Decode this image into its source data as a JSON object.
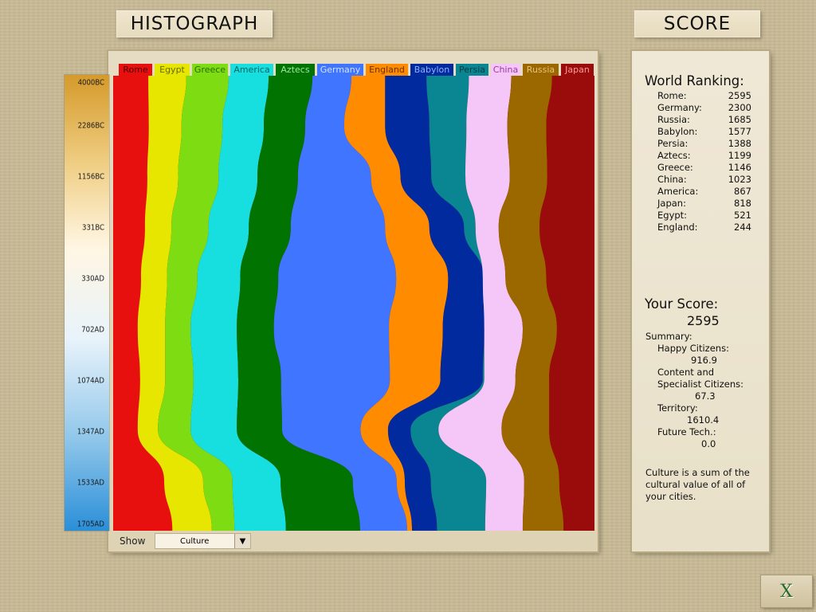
{
  "titles": {
    "histograph": "HISTOGRAPH",
    "score": "SCORE"
  },
  "timeline": [
    "4000BC",
    "2286BC",
    "1156BC",
    "331BC",
    "330AD",
    "702AD",
    "1074AD",
    "1347AD",
    "1533AD",
    "1705AD"
  ],
  "chart_data": {
    "type": "area",
    "stacked": true,
    "metric": "Culture",
    "series": [
      {
        "name": "Rome",
        "color": "#e80f0f",
        "label_bg": "#e80f0f",
        "label_fg": "#4b0000"
      },
      {
        "name": "Egypt",
        "color": "#e6e600",
        "label_bg": "#e6e600",
        "label_fg": "#6a6a00"
      },
      {
        "name": "Greece",
        "color": "#7ddd12",
        "label_bg": "#7ddd12",
        "label_fg": "#2d6a00"
      },
      {
        "name": "America",
        "color": "#18dfdf",
        "label_bg": "#18dfdf",
        "label_fg": "#066"
      },
      {
        "name": "Aztecs",
        "color": "#007300",
        "label_bg": "#007300",
        "label_fg": "#9fe89f"
      },
      {
        "name": "Germany",
        "color": "#3f75ff",
        "label_bg": "#3f75ff",
        "label_fg": "#d5e2ff"
      },
      {
        "name": "England",
        "color": "#ff8c00",
        "label_bg": "#ff8c00",
        "label_fg": "#6a2f00"
      },
      {
        "name": "Babylon",
        "color": "#002a9e",
        "label_bg": "#002a9e",
        "label_fg": "#8fb0ff"
      },
      {
        "name": "Persia",
        "color": "#0a8692",
        "label_bg": "#0a8692",
        "label_fg": "#003a40"
      },
      {
        "name": "China",
        "color": "#f5c6f8",
        "label_bg": "#f5c6f8",
        "label_fg": "#9b3aa2"
      },
      {
        "name": "Russia",
        "color": "#9b6800",
        "label_bg": "#9b6800",
        "label_fg": "#e9c27a"
      },
      {
        "name": "Japan",
        "color": "#9a0b0b",
        "label_bg": "#9a0b0b",
        "label_fg": "#ff9a9a"
      }
    ],
    "time": [
      "4000BC",
      "2286BC",
      "1156BC",
      "331BC",
      "330AD",
      "702AD",
      "1074AD",
      "1347AD",
      "1533AD",
      "1705AD"
    ],
    "boundaries_percent": [
      [
        0,
        7.3,
        15.2,
        24.0,
        32.3,
        41.4,
        49.5,
        56.5,
        65.1,
        73.9,
        82.7,
        91.2,
        100
      ],
      [
        0,
        7.4,
        14.2,
        22.7,
        31.3,
        39.9,
        48.0,
        56.5,
        65.7,
        73.4,
        81.9,
        90.0,
        100
      ],
      [
        0,
        7.1,
        13.5,
        21.9,
        30.0,
        38.4,
        53.6,
        59.7,
        66.1,
        73.2,
        82.4,
        90.2,
        100
      ],
      [
        0,
        6.6,
        12.1,
        19.8,
        28.2,
        36.9,
        56.5,
        65.7,
        72.9,
        75.3,
        80.1,
        88.6,
        100
      ],
      [
        0,
        5.8,
        11.2,
        17.5,
        26.4,
        34.3,
        58.8,
        69.6,
        77.0,
        76.8,
        81.5,
        90.0,
        100
      ],
      [
        0,
        5.1,
        10.8,
        16.1,
        25.7,
        33.4,
        57.3,
        68.5,
        77.1,
        77.1,
        85.1,
        92.2,
        100
      ],
      [
        0,
        5.6,
        10.8,
        16.7,
        26.0,
        34.9,
        57.5,
        68.0,
        76.8,
        77.1,
        83.6,
        90.6,
        100
      ],
      [
        0,
        5.1,
        9.3,
        16.1,
        25.7,
        35.1,
        51.4,
        57.1,
        61.8,
        67.6,
        80.7,
        90.6,
        100
      ],
      [
        0,
        10.6,
        18.7,
        24.8,
        34.8,
        49.8,
        58.9,
        60.6,
        66.0,
        77.5,
        85.4,
        92.7,
        100
      ],
      [
        0,
        12.3,
        20.5,
        25.2,
        35.9,
        51.3,
        61.1,
        62.1,
        67.3,
        77.3,
        85.1,
        93.6,
        100
      ]
    ]
  },
  "show": {
    "label": "Show",
    "value": "Culture"
  },
  "ranking": {
    "heading": "World Ranking:",
    "rows": [
      {
        "name": "Rome:",
        "score": "2595"
      },
      {
        "name": "Germany:",
        "score": "2300"
      },
      {
        "name": "Russia:",
        "score": "1685"
      },
      {
        "name": "Babylon:",
        "score": "1577"
      },
      {
        "name": "Persia:",
        "score": "1388"
      },
      {
        "name": "Aztecs:",
        "score": "1199"
      },
      {
        "name": "Greece:",
        "score": "1146"
      },
      {
        "name": "China:",
        "score": "1023"
      },
      {
        "name": "America:",
        "score": "867"
      },
      {
        "name": "Japan:",
        "score": "818"
      },
      {
        "name": "Egypt:",
        "score": "521"
      },
      {
        "name": "England:",
        "score": "244"
      }
    ]
  },
  "your_score": {
    "heading": "Your Score:",
    "value": "2595",
    "summary_label": "Summary:",
    "happy_label": "Happy Citizens:",
    "happy_value": "916.9",
    "content_label_1": "Content and",
    "content_label_2": "Specialist Citizens:",
    "content_value": "67.3",
    "territory_label": "Territory:",
    "territory_value": "1610.4",
    "future_label": "Future Tech.:",
    "future_value": "0.0"
  },
  "note": [
    "Culture is a sum of the",
    "cultural value of all of",
    "your cities."
  ],
  "close": {
    "icon": "close-x-icon"
  }
}
